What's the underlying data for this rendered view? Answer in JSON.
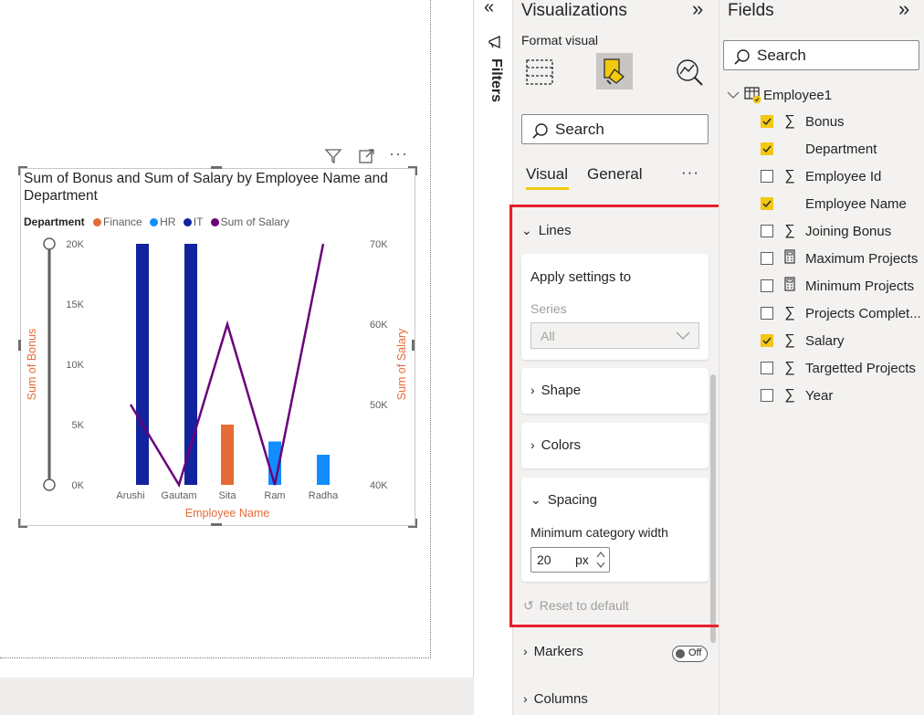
{
  "visual": {
    "title": "Sum of Bonus and Sum of Salary by Employee Name and Department",
    "legend_title": "Department",
    "legend": [
      {
        "label": "Finance",
        "color": "#e66c37"
      },
      {
        "label": "HR",
        "color": "#118dff"
      },
      {
        "label": "IT",
        "color": "#12239e"
      },
      {
        "label": "Sum of Salary",
        "color": "#6b007b"
      }
    ]
  },
  "chart_data": {
    "type": "bar",
    "categories": [
      "Arushi",
      "Gautam",
      "Sita",
      "Ram",
      "Radha"
    ],
    "xlabel": "Employee Name",
    "ylabel": "Sum of Bonus",
    "y2label": "Sum of Salary",
    "ylim": [
      0,
      20000
    ],
    "y2lim": [
      40000,
      70000
    ],
    "y_ticks": [
      "0K",
      "5K",
      "10K",
      "15K",
      "20K"
    ],
    "y2_ticks": [
      "40K",
      "50K",
      "60K",
      "70K"
    ],
    "series": [
      {
        "name": "IT",
        "type": "bar",
        "color": "#12239e",
        "values": [
          20000,
          20000,
          null,
          null,
          null
        ]
      },
      {
        "name": "Finance",
        "type": "bar",
        "color": "#e66c37",
        "values": [
          null,
          null,
          5000,
          null,
          null
        ]
      },
      {
        "name": "HR",
        "type": "bar",
        "color": "#118dff",
        "values": [
          null,
          null,
          null,
          3600,
          2500
        ]
      },
      {
        "name": "Sum of Salary",
        "type": "line",
        "axis": "secondary",
        "color": "#6b007b",
        "values": [
          50000,
          40000,
          60000,
          40000,
          70000
        ]
      }
    ]
  },
  "filters": {
    "label": "Filters"
  },
  "viz_pane": {
    "title": "Visualizations",
    "format_label": "Format visual",
    "search_placeholder": "Search",
    "tabs": [
      "Visual",
      "General"
    ],
    "more": "···",
    "lines_section": "Lines",
    "apply_settings": "Apply settings to",
    "series_label": "Series",
    "series_value": "All",
    "shape": "Shape",
    "colors": "Colors",
    "spacing": "Spacing",
    "min_cat_width_label": "Minimum category width",
    "min_cat_width_value": "20",
    "min_cat_width_unit": "px",
    "reset": "Reset to default",
    "markers": "Markers",
    "markers_toggle": "Off",
    "columns": "Columns"
  },
  "fields_pane": {
    "title": "Fields",
    "search_placeholder": "Search",
    "table_name": "Employee1",
    "fields": [
      {
        "name": "Bonus",
        "checked": true,
        "icon": "sigma-icon"
      },
      {
        "name": "Department",
        "checked": true,
        "icon": ""
      },
      {
        "name": "Employee Id",
        "checked": false,
        "icon": "sigma-icon"
      },
      {
        "name": "Employee Name",
        "checked": true,
        "icon": ""
      },
      {
        "name": "Joining Bonus",
        "checked": false,
        "icon": "sigma-icon"
      },
      {
        "name": "Maximum Projects",
        "checked": false,
        "icon": "calculator-icon"
      },
      {
        "name": "Minimum Projects",
        "checked": false,
        "icon": "calculator-icon"
      },
      {
        "name": "Projects Complet...",
        "checked": false,
        "icon": "sigma-icon"
      },
      {
        "name": "Salary",
        "checked": true,
        "icon": "sigma-icon"
      },
      {
        "name": "Targetted Projects",
        "checked": false,
        "icon": "sigma-icon"
      },
      {
        "name": "Year",
        "checked": false,
        "icon": "sigma-icon"
      }
    ]
  }
}
